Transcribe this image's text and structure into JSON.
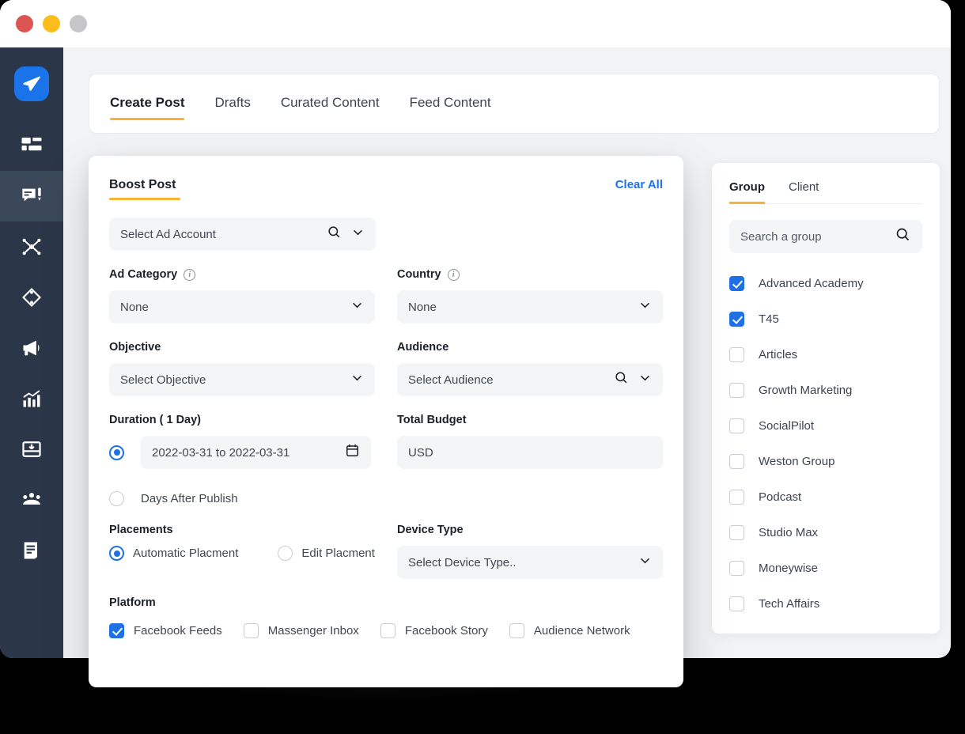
{
  "window": {
    "traffic_lights": [
      "close",
      "minimize",
      "maximize"
    ],
    "colors": {
      "red": "#dc5552",
      "yellow": "#fbbd1c",
      "gray": "#c6c6c8",
      "sidebar": "#2b3648",
      "accent_yellow": "#f9b233",
      "accent_blue": "#1f6fe5",
      "link_blue": "#1a73e8"
    }
  },
  "sidebar": {
    "items": [
      {
        "icon": "paper-plane-logo-icon",
        "active": false
      },
      {
        "icon": "dashboard-grid-icon",
        "active": false
      },
      {
        "icon": "compose-post-icon",
        "active": true
      },
      {
        "icon": "network-nodes-icon",
        "active": false
      },
      {
        "icon": "sync-exchange-icon",
        "active": false
      },
      {
        "icon": "megaphone-icon",
        "active": false
      },
      {
        "icon": "analytics-chart-icon",
        "active": false
      },
      {
        "icon": "inbox-download-icon",
        "active": false
      },
      {
        "icon": "team-people-icon",
        "active": false
      },
      {
        "icon": "document-report-icon",
        "active": false
      }
    ]
  },
  "tabs": [
    {
      "label": "Create Post",
      "active": true
    },
    {
      "label": "Drafts",
      "active": false
    },
    {
      "label": "Curated Content",
      "active": false
    },
    {
      "label": "Feed Content",
      "active": false
    }
  ],
  "boost": {
    "title": "Boost Post",
    "clear_all": "Clear All",
    "ad_account": {
      "placeholder": "Select Ad Account",
      "value": "Select Ad Account"
    },
    "ad_category": {
      "label": "Ad Category",
      "value": "None",
      "has_info": true
    },
    "country": {
      "label": "Country",
      "value": "None",
      "has_info": true
    },
    "objective": {
      "label": "Objective",
      "value": "Select Objective"
    },
    "audience": {
      "label": "Audience",
      "value": "Select Audience"
    },
    "duration": {
      "label": "Duration ( 1 Day)",
      "date_range": "2022-03-31 to 2022-03-31",
      "days_after_publish": "Days After Publish",
      "selected": "date_range"
    },
    "total_budget": {
      "label": "Total Budget",
      "value": "USD"
    },
    "placements": {
      "label": "Placements",
      "options": [
        {
          "label": "Automatic Placment",
          "selected": true
        },
        {
          "label": "Edit Placment",
          "selected": false
        }
      ]
    },
    "device_type": {
      "label": "Device Type",
      "value": "Select Device Type.."
    },
    "platform": {
      "label": "Platform",
      "options": [
        {
          "label": "Facebook Feeds",
          "checked": true
        },
        {
          "label": "Massenger Inbox",
          "checked": false
        },
        {
          "label": "Facebook Story",
          "checked": false
        },
        {
          "label": "Audience Network",
          "checked": false
        }
      ]
    }
  },
  "group_panel": {
    "tabs": [
      {
        "label": "Group",
        "active": true
      },
      {
        "label": "Client",
        "active": false
      }
    ],
    "search_placeholder": "Search a group",
    "items": [
      {
        "label": "Advanced Academy",
        "checked": true
      },
      {
        "label": "T45",
        "checked": true
      },
      {
        "label": "Articles",
        "checked": false
      },
      {
        "label": "Growth Marketing",
        "checked": false
      },
      {
        "label": "SocialPilot",
        "checked": false
      },
      {
        "label": "Weston Group",
        "checked": false
      },
      {
        "label": "Podcast",
        "checked": false
      },
      {
        "label": "Studio Max",
        "checked": false
      },
      {
        "label": "Moneywise",
        "checked": false
      },
      {
        "label": "Tech Affairs",
        "checked": false
      }
    ]
  }
}
